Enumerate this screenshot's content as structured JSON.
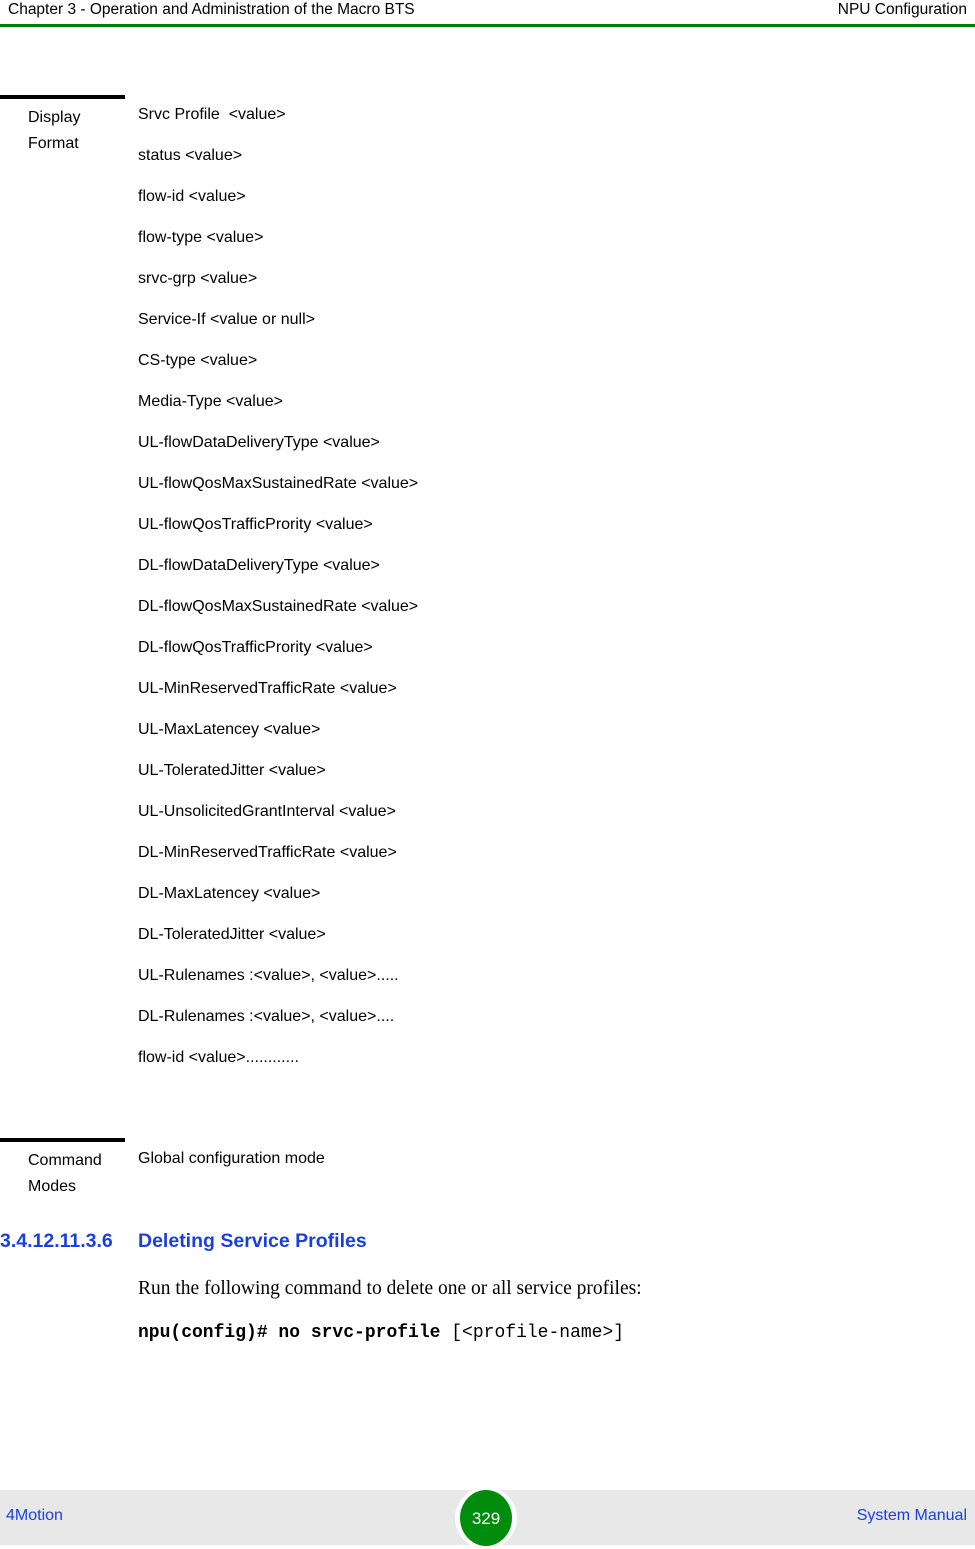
{
  "header": {
    "left": "Chapter 3 - Operation and Administration of the Macro BTS",
    "right": "NPU Configuration",
    "rule_color": "#008000"
  },
  "spec_table": {
    "display_format": {
      "label_lines": [
        "Display",
        "Format"
      ],
      "lines": [
        "Srvc Profile  <value>",
        "status <value>",
        "flow-id <value>",
        "flow-type <value>",
        "srvc-grp <value>",
        "Service-If <value or null>",
        "CS-type <value>",
        "Media-Type <value>",
        "UL-flowDataDeliveryType <value>",
        "UL-flowQosMaxSustainedRate <value>",
        "UL-flowQosTrafficPrority <value>",
        "DL-flowDataDeliveryType <value>",
        "DL-flowQosMaxSustainedRate <value>",
        "DL-flowQosTrafficPrority <value>",
        "UL-MinReservedTrafficRate <value>",
        "UL-MaxLatencey <value>",
        "UL-ToleratedJitter <value>",
        "UL-UnsolicitedGrantInterval <value>",
        "DL-MinReservedTrafficRate <value>",
        "DL-MaxLatencey <value>",
        "DL-ToleratedJitter <value>",
        "UL-Rulenames :<value>, <value>.....",
        "DL-Rulenames :<value>, <value>....",
        "flow-id <value>............"
      ]
    },
    "command_modes": {
      "label_lines": [
        "Command",
        "Modes"
      ],
      "value": "Global configuration mode"
    }
  },
  "section": {
    "number": "3.4.12.11.3.6",
    "title": "Deleting Service Profiles",
    "color": "#1a3fe0"
  },
  "body": {
    "paragraph": "Run the following command to delete one or all service profiles:"
  },
  "cli": {
    "prompt_command": "npu(config)# no srvc-profile",
    "argument": " [<profile-name>]"
  },
  "footer": {
    "left": "4Motion",
    "right": "System Manual",
    "page_number": "329",
    "badge_color": "#008c0c",
    "band_color": "#e8e8e8",
    "link_color": "#1a3fe0"
  }
}
